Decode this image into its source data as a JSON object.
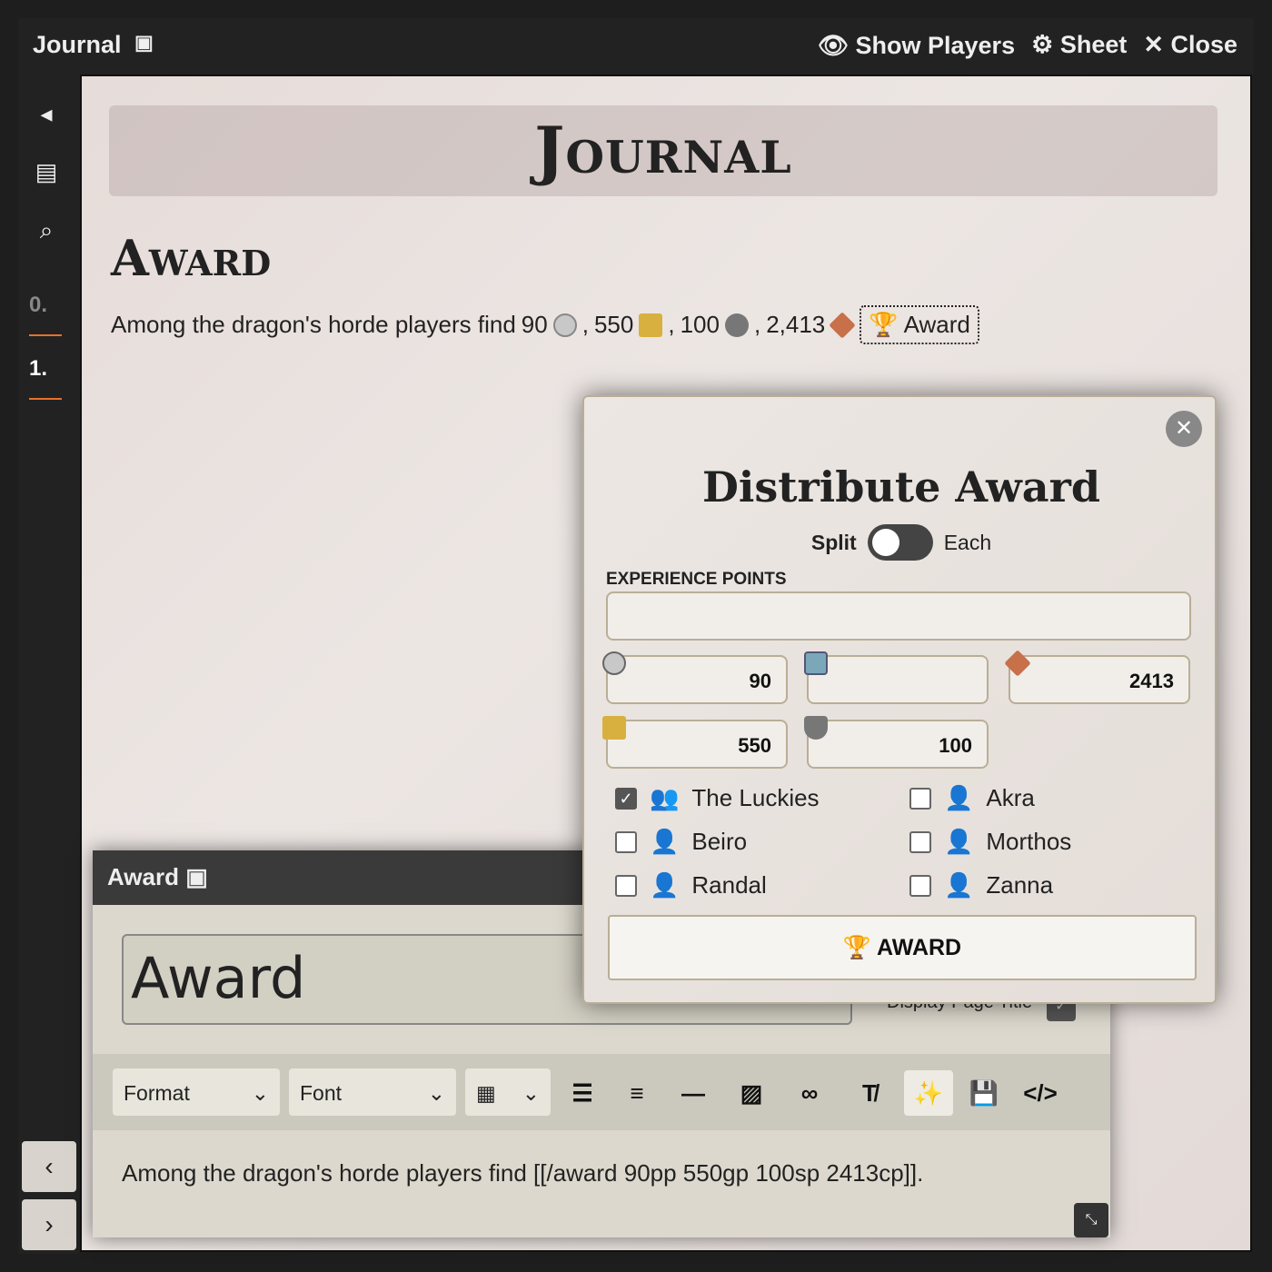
{
  "topbar": {
    "title": "Journal",
    "show_players": "Show Players",
    "sheet": "Sheet",
    "close": "Close"
  },
  "sidebar": {
    "pages": [
      "0.",
      "1."
    ],
    "active": "1."
  },
  "page": {
    "banner": "Journal",
    "heading": "Award",
    "text_prefix": "Among the dragon's horde players find",
    "pp": "90",
    "gp": "550",
    "sp": "100",
    "cp": "2,413",
    "award_link": "Award"
  },
  "editor": {
    "header": "Award",
    "title_value": "Award",
    "display_title_label": "Display Page Title",
    "format": "Format",
    "font": "Font",
    "content": "Among the dragon's horde players find [[/award 90pp 550gp 100sp 2413cp]]."
  },
  "dialog": {
    "title": "Distribute Award",
    "split": "Split",
    "each": "Each",
    "split_mode_on": false,
    "xp_label": "EXPERIENCE POINTS",
    "xp_value": "",
    "pp": "90",
    "ep": "",
    "cp": "2413",
    "gp": "550",
    "sp": "100",
    "members": [
      {
        "name": "The Luckies",
        "checked": true,
        "icon": "users-icon"
      },
      {
        "name": "Akra",
        "checked": false,
        "icon": "user-icon"
      },
      {
        "name": "Beiro",
        "checked": false,
        "icon": "user-icon"
      },
      {
        "name": "Morthos",
        "checked": false,
        "icon": "user-icon"
      },
      {
        "name": "Randal",
        "checked": false,
        "icon": "user-icon"
      },
      {
        "name": "Zanna",
        "checked": false,
        "icon": "user-icon"
      }
    ],
    "award_button": "AWARD"
  },
  "colors": {
    "accent": "#e8702a",
    "pp": "#c8c8c8",
    "gp": "#d8b040",
    "sp": "#777777",
    "cp": "#c8704a",
    "ep": "#7aa8b8"
  }
}
